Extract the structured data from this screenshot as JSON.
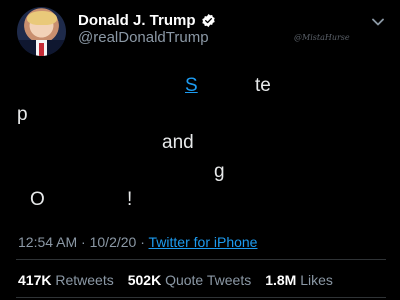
{
  "author": {
    "display_name": "Donald J. Trump",
    "handle": "@realDonaldTrump"
  },
  "watermark": "@MistaHurse",
  "body_fragments": [
    {
      "text": "S",
      "link": true
    },
    {
      "text": "te",
      "link": false
    },
    {
      "text": "p",
      "link": false
    },
    {
      "text": "and",
      "link": false
    },
    {
      "text": "g",
      "link": false
    },
    {
      "text": "O",
      "link": false
    },
    {
      "text": "!",
      "link": false
    }
  ],
  "meta": {
    "time": "12:54 AM",
    "separator": "·",
    "date": "10/2/20",
    "separator2": "·",
    "source": "Twitter for iPhone"
  },
  "stats": {
    "retweets_count": "417K",
    "retweets_label": "Retweets",
    "quote_count": "502K",
    "quote_label": "Quote Tweets",
    "likes_count": "1.8M",
    "likes_label": "Likes"
  },
  "icons": {
    "avatar": "profile-photo",
    "verified": "verified-badge-icon",
    "menu": "chevron-down-icon"
  },
  "colors": {
    "background": "#000000",
    "text": "#e7e9ea",
    "secondary_text": "#8b98a5",
    "link": "#1d9bf0",
    "divider": "#2f3336"
  }
}
